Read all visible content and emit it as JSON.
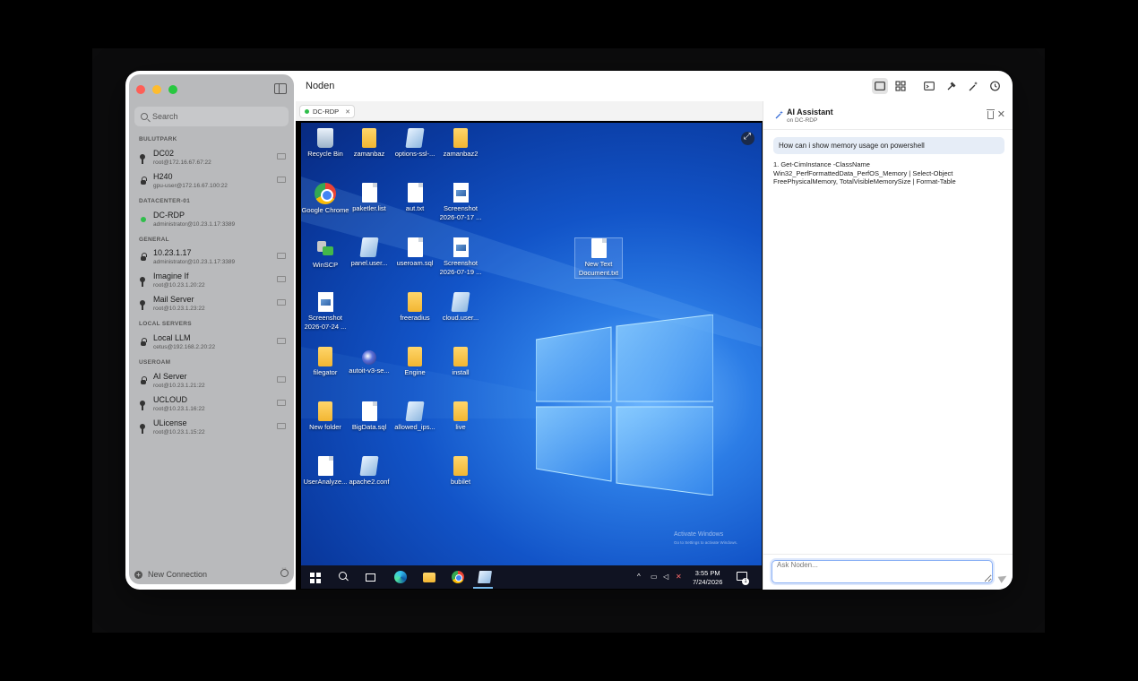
{
  "app": {
    "title": "Noden"
  },
  "sidebar": {
    "search_placeholder": "Search",
    "groups": [
      {
        "label": "BULUTPARK",
        "items": [
          {
            "name": "DC02",
            "sub": "root@172.16.67.67:22",
            "icon": "key-icon"
          },
          {
            "name": "H240",
            "sub": "gpu-user@172.16.67.100:22",
            "icon": "lock-icon"
          }
        ]
      },
      {
        "label": "DATACENTER-01",
        "items": [
          {
            "name": "DC-RDP",
            "sub": "administrator@10.23.1.17:3389",
            "icon": "connected-dot"
          }
        ]
      },
      {
        "label": "GENERAL",
        "items": [
          {
            "name": "10.23.1.17",
            "sub": "administrator@10.23.1.17:3389",
            "icon": "lock-icon"
          },
          {
            "name": "Imagine If",
            "sub": "root@10.23.1.20:22",
            "icon": "key-icon"
          },
          {
            "name": "Mail Server",
            "sub": "root@10.23.1.23:22",
            "icon": "key-icon"
          }
        ]
      },
      {
        "label": "LOCAL SERVERS",
        "items": [
          {
            "name": "Local LLM",
            "sub": "cetus@192.168.2.20:22",
            "icon": "lock-icon"
          }
        ]
      },
      {
        "label": "USEROAM",
        "items": [
          {
            "name": "AI Server",
            "sub": "root@10.23.1.21:22",
            "icon": "lock-icon"
          },
          {
            "name": "UCLOUD",
            "sub": "root@10.23.1.16:22",
            "icon": "key-icon"
          },
          {
            "name": "ULicense",
            "sub": "root@10.23.1.15:22",
            "icon": "key-icon"
          }
        ]
      }
    ],
    "new_connection": "New Connection"
  },
  "tabs": [
    {
      "label": "DC-RDP",
      "status_color": "#2fbe4b"
    }
  ],
  "desktop": {
    "icons": [
      {
        "label": "Recycle Bin",
        "type": "bin"
      },
      {
        "label": "zamanbaz",
        "type": "folder"
      },
      {
        "label": "options-ssl-...",
        "type": "note"
      },
      {
        "label": "zamanbaz2",
        "type": "folder"
      },
      {
        "label": "Google Chrome",
        "type": "chrome"
      },
      {
        "label": "paketler.list",
        "type": "file"
      },
      {
        "label": "aut.txt",
        "type": "file"
      },
      {
        "label": "Screenshot 2026-07-17 ...",
        "type": "shot"
      },
      {
        "label": "WinSCP",
        "type": "winscp"
      },
      {
        "label": "panel.user...",
        "type": "note"
      },
      {
        "label": "useroam.sql",
        "type": "file"
      },
      {
        "label": "Screenshot 2026-07-19 ...",
        "type": "shot"
      },
      {
        "label": "New Text Document.txt",
        "type": "file"
      },
      {
        "label": "Screenshot 2026-07-24 ...",
        "type": "shot"
      },
      {
        "label": "freeradius",
        "type": "folder"
      },
      {
        "label": "cloud.user...",
        "type": "note"
      },
      {
        "label": "filegator",
        "type": "folder"
      },
      {
        "label": "autoit-v3-se...",
        "type": "autoit"
      },
      {
        "label": "Engine",
        "type": "folder"
      },
      {
        "label": "install",
        "type": "folder"
      },
      {
        "label": "New folder",
        "type": "folder"
      },
      {
        "label": "BigData.sql",
        "type": "file"
      },
      {
        "label": "allowed_ips...",
        "type": "note"
      },
      {
        "label": "live",
        "type": "folder"
      },
      {
        "label": "UserAnalyze...",
        "type": "file"
      },
      {
        "label": "apache2.conf",
        "type": "note"
      },
      {
        "label": "bubilet",
        "type": "folder"
      }
    ],
    "activate_title": "Activate Windows",
    "activate_sub": "Go to Settings to activate Windows.",
    "clock_time": "3:55 PM",
    "clock_date": "7/24/2026",
    "notification_count": "1"
  },
  "ai": {
    "title": "AI Assistant",
    "subtitle": "on DC-RDP",
    "user_message": "How can i show memory usage on powershell",
    "assistant_message": "1. Get-CimInstance -ClassName Win32_PerfFormattedData_PerfOS_Memory | Select-Object FreePhysicalMemory, TotalVisibleMemorySize | Format-Table",
    "input_placeholder": "Ask Noden..."
  }
}
